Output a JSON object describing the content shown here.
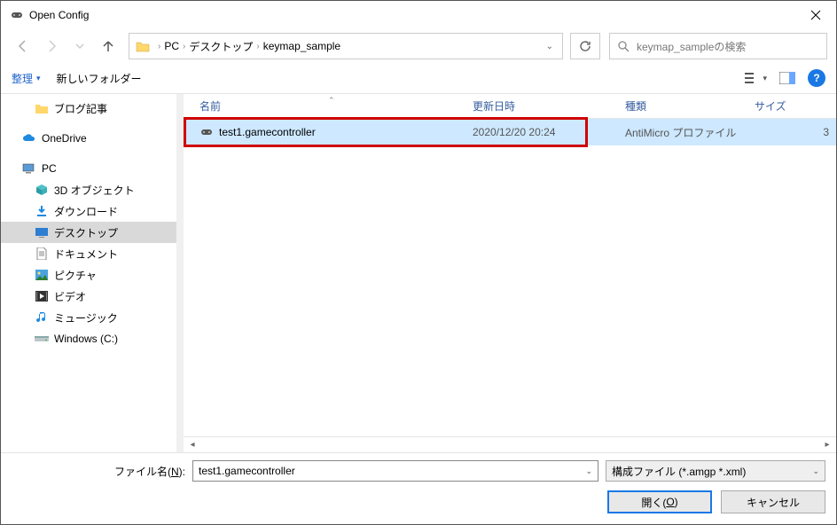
{
  "window": {
    "title": "Open Config"
  },
  "breadcrumb": [
    "PC",
    "デスクトップ",
    "keymap_sample"
  ],
  "search": {
    "placeholder": "keymap_sampleの検索"
  },
  "toolbar": {
    "organize": "整理",
    "newfolder": "新しいフォルダー"
  },
  "columns": {
    "name": "名前",
    "date": "更新日時",
    "type": "種類",
    "size": "サイズ"
  },
  "tree": {
    "blog": "ブログ記事",
    "onedrive": "OneDrive",
    "pc": "PC",
    "obj3d": "3D オブジェクト",
    "downloads": "ダウンロード",
    "desktop": "デスクトップ",
    "documents": "ドキュメント",
    "pictures": "ピクチャ",
    "videos": "ビデオ",
    "music": "ミュージック",
    "cdrive": "Windows (C:)"
  },
  "file": {
    "name": "test1.gamecontroller",
    "date": "2020/12/20 20:24",
    "type": "AntiMicro プロファイル",
    "size": "3"
  },
  "footer": {
    "label_pre": "ファイル名(",
    "label_key": "N",
    "label_post": "):",
    "filename": "test1.gamecontroller",
    "filter": "構成ファイル (*.amgp *.xml)",
    "open_pre": "開く(",
    "open_key": "O",
    "open_post": ")",
    "cancel": "キャンセル"
  }
}
